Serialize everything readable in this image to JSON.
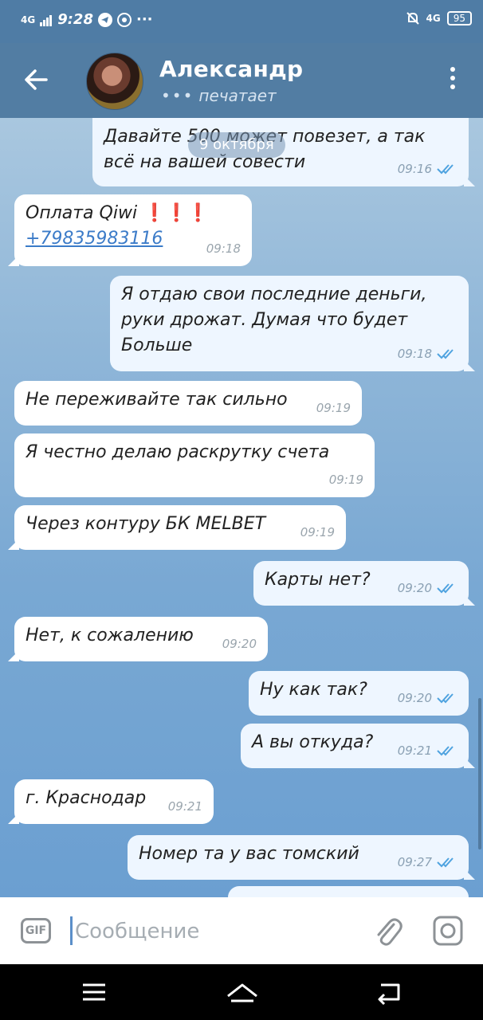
{
  "status_bar": {
    "left_signal": "4G",
    "time": "9:28",
    "dots": "···",
    "right_signal": "4G",
    "battery": "95"
  },
  "header": {
    "name": "Александр",
    "status_dots": "•••",
    "status": "печатает"
  },
  "date_chip": "9 октября",
  "messages": [
    {
      "dir": "out",
      "text": "Давайте 500 может повезет, а так всё на вашей совести",
      "time": "09:16",
      "read": true
    },
    {
      "dir": "in",
      "text": "Оплата Qiwi",
      "alarm": "❗❗❗",
      "link": "+79835983116",
      "time": "09:18"
    },
    {
      "dir": "out",
      "text": "Я отдаю свои последние деньги, руки дрожат. Думая что будет Больше",
      "time": "09:18",
      "read": true
    },
    {
      "dir": "in",
      "text": "Не переживайте так сильно",
      "time": "09:19"
    },
    {
      "dir": "in",
      "text": "Я честно делаю раскрутку счета",
      "time": "09:19"
    },
    {
      "dir": "in",
      "text": "Через контуру БК MELBET",
      "time": "09:19"
    },
    {
      "dir": "out",
      "text": "Карты нет?",
      "time": "09:20",
      "read": true
    },
    {
      "dir": "in",
      "text": "Нет, к сожалению",
      "time": "09:20"
    },
    {
      "dir": "out",
      "text": "Ну как так?",
      "time": "09:20",
      "read": true
    },
    {
      "dir": "out",
      "text": "А вы откуда?",
      "time": "09:21",
      "read": true
    },
    {
      "dir": "in",
      "text": "г. Краснодар",
      "time": "09:21"
    },
    {
      "dir": "out",
      "text": "Номер та у вас томский",
      "time": "09:27",
      "read": true
    }
  ],
  "composer": {
    "gif_label": "GIF",
    "placeholder": "Сообщение"
  },
  "icons": {
    "back": "back-arrow-icon",
    "menu": "more-vertical-icon",
    "attach": "paperclip-icon",
    "camera": "camera-icon",
    "read": "double-check-icon",
    "nav_menu": "hamburger-icon",
    "nav_home": "home-icon",
    "nav_back": "return-icon"
  },
  "colors": {
    "header": "#527da3",
    "accent_ticks": "#4fa3e0",
    "link": "#3b7bc8"
  }
}
